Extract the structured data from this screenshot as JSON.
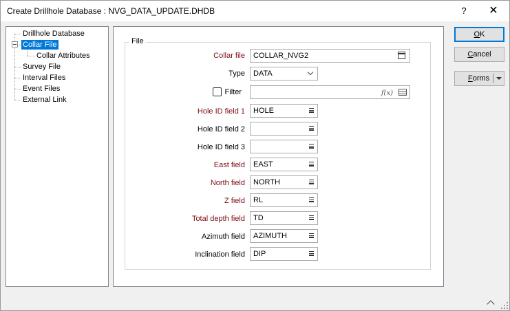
{
  "window": {
    "title": "Create Drillhole Database : NVG_DATA_UPDATE.DHDB",
    "help_glyph": "?",
    "close_glyph": "✕"
  },
  "tree": {
    "items": [
      {
        "label": "Drillhole Database"
      },
      {
        "label": "Collar File",
        "selected": true
      },
      {
        "label": "Collar Attributes"
      },
      {
        "label": "Survey File"
      },
      {
        "label": "Interval Files"
      },
      {
        "label": "Event Files"
      },
      {
        "label": "External Link"
      }
    ]
  },
  "form": {
    "group_label": "File",
    "collar_file": {
      "label": "Collar file",
      "value": "COLLAR_NVG2"
    },
    "type": {
      "label": "Type",
      "value": "DATA"
    },
    "filter": {
      "label": "Filter",
      "value": "",
      "fx_glyph": "f(x)"
    },
    "fields": [
      {
        "label": "Hole ID field 1",
        "value": "HOLE",
        "required": true
      },
      {
        "label": "Hole ID field 2",
        "value": "",
        "required": false
      },
      {
        "label": "Hole ID field 3",
        "value": "",
        "required": false
      },
      {
        "label": "East field",
        "value": "EAST",
        "required": true
      },
      {
        "label": "North field",
        "value": "NORTH",
        "required": true
      },
      {
        "label": "Z field",
        "value": "RL",
        "required": true
      },
      {
        "label": "Total depth field",
        "value": "TD",
        "required": true
      },
      {
        "label": "Azimuth field",
        "value": "AZIMUTH",
        "required": false
      },
      {
        "label": "Inclination field",
        "value": "DIP",
        "required": false
      }
    ]
  },
  "buttons": {
    "ok": {
      "mnemonic": "O",
      "rest": "K"
    },
    "cancel": {
      "mnemonic": "C",
      "rest": "ancel"
    },
    "forms": {
      "mnemonic": "F",
      "rest": "orms"
    }
  },
  "colors": {
    "required_label": "#7b0c12",
    "selection": "#0078d7"
  }
}
